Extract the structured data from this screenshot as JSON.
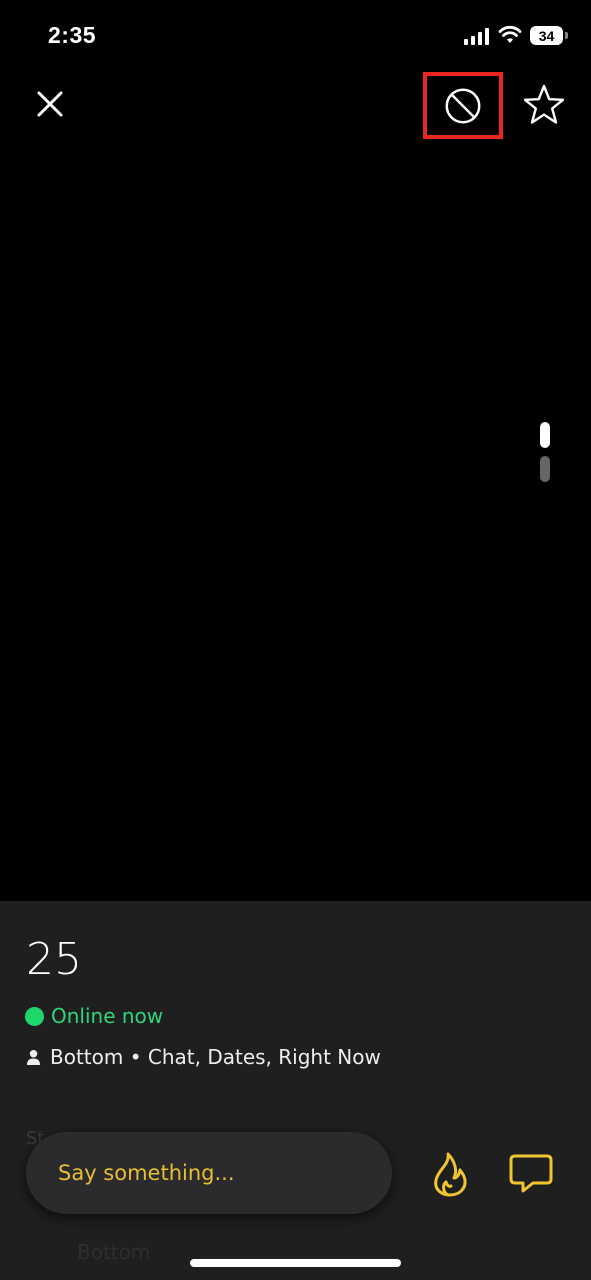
{
  "status_bar": {
    "time": "2:35",
    "battery_level": "34",
    "signal_icon": "cellular-signal-icon",
    "wifi_icon": "wifi-icon"
  },
  "top_bar": {
    "close_icon": "close-icon",
    "block_icon": "block-icon",
    "favorite_icon": "star-icon",
    "highlight_color": "#e8281e"
  },
  "photo_pager": {
    "total": 2,
    "current": 1
  },
  "profile": {
    "age": "25",
    "status": "Online now",
    "status_color": "#1ed66b",
    "details": "Bottom • Chat, Dates, Right Now",
    "ghost_section_label": "St",
    "ghost_position_value": "Bottom"
  },
  "composer": {
    "placeholder": "Say something...",
    "accent_color": "#f0c531",
    "tap_icon": "flame-icon",
    "chat_icon": "chat-bubble-icon"
  }
}
